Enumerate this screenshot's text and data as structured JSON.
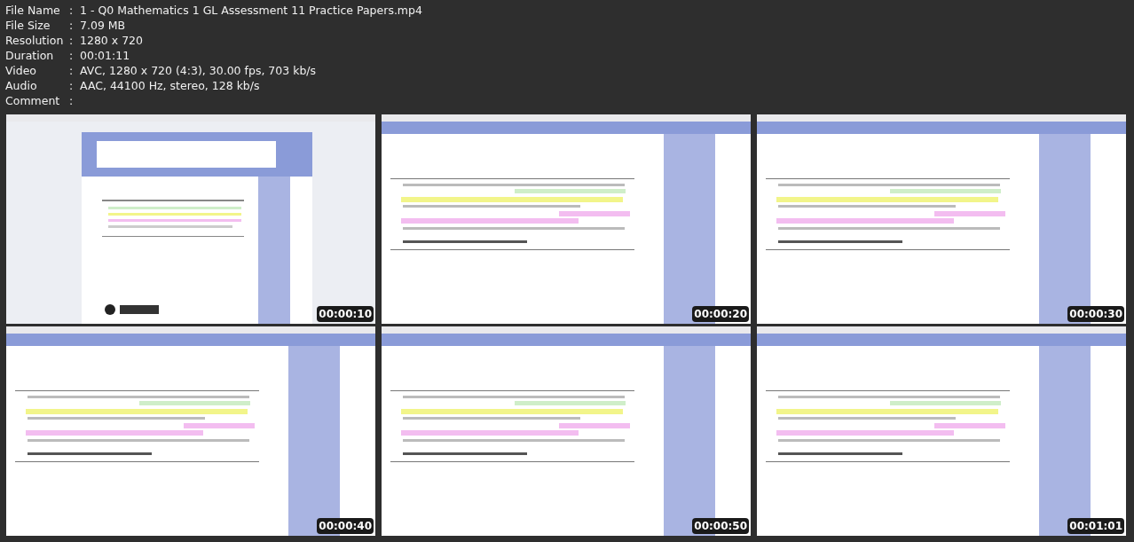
{
  "info": [
    {
      "label": "File Name",
      "value": "1 - Q0 Mathematics 1 GL Assessment 11 Practice Papers.mp4"
    },
    {
      "label": "File Size",
      "value": "7.09 MB"
    },
    {
      "label": "Resolution",
      "value": "1280 x 720"
    },
    {
      "label": "Duration",
      "value": "00:01:11"
    },
    {
      "label": "Video",
      "value": "AVC, 1280 x 720 (4:3), 30.00 fps, 703 kb/s"
    },
    {
      "label": "Audio",
      "value": "AAC, 44100 Hz, stereo, 128 kb/s"
    },
    {
      "label": "Comment"
    }
  ],
  "separator": ":",
  "frames": [
    {
      "kind": "picture",
      "timestamp": "00:00:10"
    },
    {
      "kind": "picture",
      "timestamp": "00:00:20"
    },
    {
      "kind": "picture",
      "timestamp": "00:00:30"
    },
    {
      "kind": "picture",
      "timestamp": "00:00:40"
    },
    {
      "kind": "picture",
      "timestamp": "00:00:50"
    },
    {
      "kind": "picture",
      "timestamp": "00:01:01"
    }
  ]
}
